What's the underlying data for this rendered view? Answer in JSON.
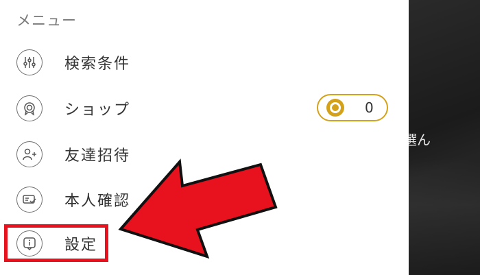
{
  "menu": {
    "title": "メニュー",
    "items": [
      {
        "label": "検索条件",
        "icon": "sliders-icon"
      },
      {
        "label": "ショップ",
        "icon": "shop-medal-icon"
      },
      {
        "label": "友達招待",
        "icon": "add-friend-icon"
      },
      {
        "label": "本人確認",
        "icon": "id-verify-icon"
      },
      {
        "label": "設定",
        "icon": "settings-info-icon"
      }
    ]
  },
  "shop_coins": {
    "count": "0",
    "icon": "coin-icon",
    "color": "#d4a21a"
  },
  "background_text": "選ん",
  "annotation": {
    "arrow_color": "#e8121e",
    "highlight_color": "#e8121e"
  }
}
